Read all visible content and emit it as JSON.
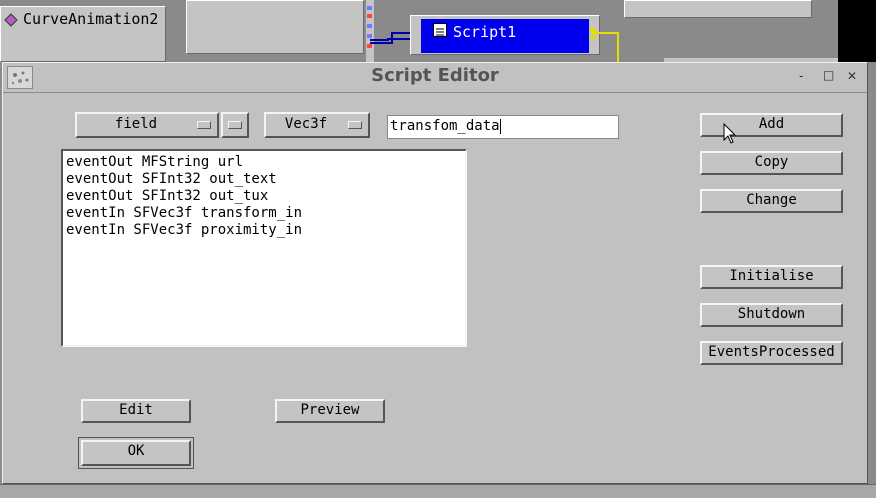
{
  "background": {
    "node_curve": "CurveAnimation2",
    "node_script": "Script1"
  },
  "window": {
    "title": "Script Editor",
    "controls": {
      "minimize": "-",
      "maximize": "□",
      "close": "✕"
    }
  },
  "field_row": {
    "kind_value": "field",
    "type_value": "Vec3f",
    "name_value": "transfom_data"
  },
  "list": {
    "items": [
      "eventOut MFString url",
      "eventOut SFInt32 out_text",
      "eventOut SFInt32 out_tux",
      "eventIn SFVec3f transform_in",
      "eventIn SFVec3f proximity_in"
    ]
  },
  "buttons": {
    "add": "Add",
    "copy": "Copy",
    "change": "Change",
    "initialise": "Initialise",
    "shutdown": "Shutdown",
    "events_processed": "EventsProcessed",
    "edit": "Edit",
    "preview": "Preview",
    "ok": "OK"
  },
  "colors": {
    "window_bg": "#c1c1c1",
    "script_node": "#0000ee",
    "title_text": "#555555"
  }
}
